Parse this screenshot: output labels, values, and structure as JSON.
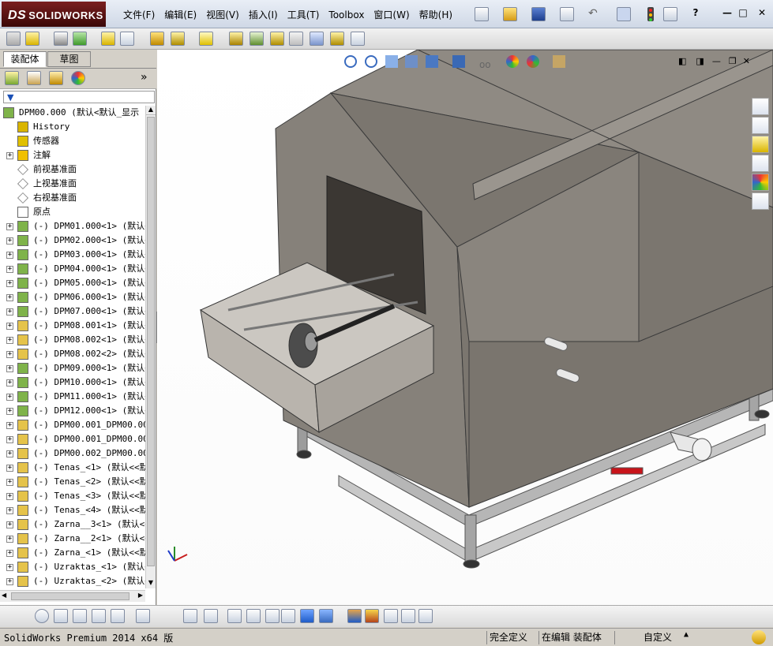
{
  "app": {
    "logo_text": "SOLIDWORKS",
    "logo_prefix": "DS"
  },
  "menu": [
    "文件(F)",
    "编辑(E)",
    "视图(V)",
    "插入(I)",
    "工具(T)",
    "Toolbox",
    "窗口(W)",
    "帮助(H)"
  ],
  "window_buttons": [
    "?",
    "—",
    "□",
    "✕"
  ],
  "left_panel": {
    "tabs": [
      "装配体",
      "草图"
    ],
    "tree_root": "DPM00.000  (默认<默认_显示",
    "tree_items": [
      {
        "label": "History",
        "icon": "history-icon",
        "expand": false
      },
      {
        "label": "传感器",
        "icon": "sensor-icon",
        "expand": false
      },
      {
        "label": "注解",
        "icon": "annotation-icon",
        "expand": true
      },
      {
        "label": "前视基准面",
        "icon": "plane-icon",
        "expand": false
      },
      {
        "label": "上视基准面",
        "icon": "plane-icon",
        "expand": false
      },
      {
        "label": "右视基准面",
        "icon": "plane-icon",
        "expand": false
      },
      {
        "label": "原点",
        "icon": "origin-icon",
        "expand": false
      },
      {
        "label": "(-) DPM01.000<1> (默认<",
        "icon": "assembly-icon",
        "expand": true
      },
      {
        "label": "(-) DPM02.000<1> (默认<",
        "icon": "assembly-icon",
        "expand": true
      },
      {
        "label": "(-) DPM03.000<1> (默认<",
        "icon": "assembly-icon",
        "expand": true
      },
      {
        "label": "(-) DPM04.000<1> (默认<",
        "icon": "assembly-icon",
        "expand": true
      },
      {
        "label": "(-) DPM05.000<1> (默认<",
        "icon": "assembly-icon",
        "expand": true
      },
      {
        "label": "(-) DPM06.000<1> (默认<",
        "icon": "assembly-icon",
        "expand": true
      },
      {
        "label": "(-) DPM07.000<1> (默认<",
        "icon": "assembly-icon",
        "expand": true
      },
      {
        "label": "(-) DPM08.001<1> (默认<",
        "icon": "part-icon",
        "expand": true
      },
      {
        "label": "(-) DPM08.002<1> (默认<",
        "icon": "part-icon",
        "expand": true
      },
      {
        "label": "(-) DPM08.002<2> (默认<",
        "icon": "part-icon",
        "expand": true
      },
      {
        "label": "(-) DPM09.000<1> (默认<",
        "icon": "assembly-icon",
        "expand": true
      },
      {
        "label": "(-) DPM10.000<1> (默认<",
        "icon": "assembly-icon",
        "expand": true
      },
      {
        "label": "(-) DPM11.000<1> (默认<",
        "icon": "assembly-icon",
        "expand": true
      },
      {
        "label": "(-) DPM12.000<1> (默认<",
        "icon": "assembly-icon",
        "expand": true
      },
      {
        "label": "(-) DPM00.001_DPM00.001",
        "icon": "part-icon",
        "expand": true
      },
      {
        "label": "(-) DPM00.001_DPM00.001",
        "icon": "part-icon",
        "expand": true
      },
      {
        "label": "(-) DPM00.002_DPM00.002",
        "icon": "part-icon",
        "expand": true
      },
      {
        "label": "(-) Tenas_<1> (默认<<默",
        "icon": "part-icon",
        "expand": true
      },
      {
        "label": "(-) Tenas_<2> (默认<<默",
        "icon": "part-icon",
        "expand": true
      },
      {
        "label": "(-) Tenas_<3> (默认<<默",
        "icon": "part-icon",
        "expand": true
      },
      {
        "label": "(-) Tenas_<4> (默认<<默",
        "icon": "part-icon",
        "expand": true
      },
      {
        "label": "(-) Zarna__3<1> (默认<<",
        "icon": "part-icon",
        "expand": true
      },
      {
        "label": "(-) Zarna__2<1> (默认<<",
        "icon": "part-icon",
        "expand": true
      },
      {
        "label": "(-) Zarna_<1> (默认<<默",
        "icon": "part-icon",
        "expand": true
      },
      {
        "label": "(-) Uzraktas_<1> (默认<",
        "icon": "part-icon",
        "expand": true
      },
      {
        "label": "(-) Uzraktas_<2> (默认<",
        "icon": "part-icon",
        "expand": true
      }
    ]
  },
  "status_bar": {
    "product": "SolidWorks Premium 2014 x64 版",
    "state1": "完全定义",
    "state2": "在编辑 装配体",
    "units": "自定义"
  },
  "colors": {
    "body_gray": "#8b867f",
    "body_dark": "#6f6a63",
    "handle_red": "#c8141a",
    "logo_red": "#7a1f1f"
  }
}
